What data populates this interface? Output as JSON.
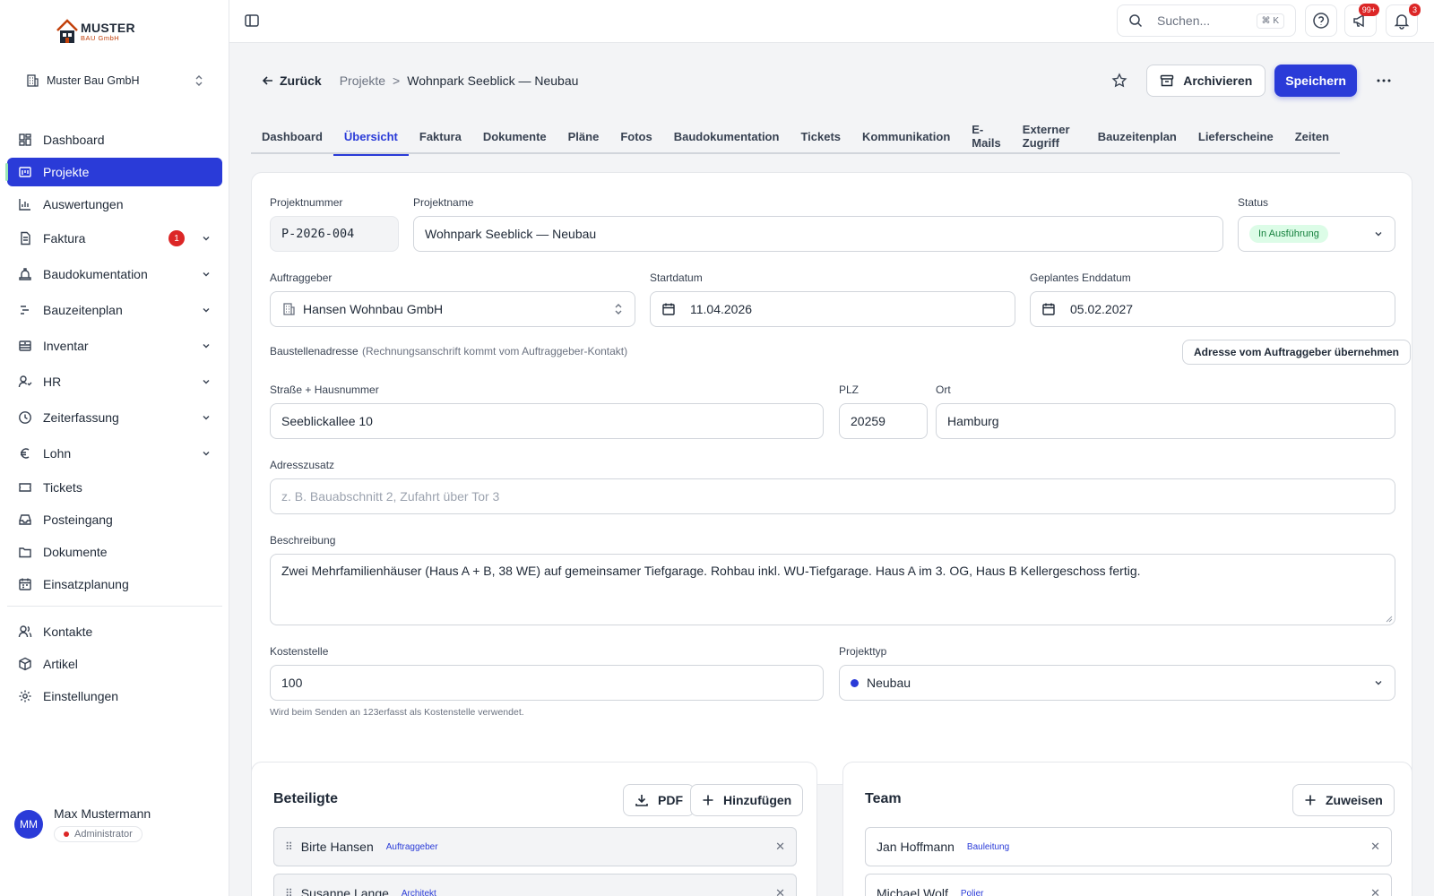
{
  "brand": {
    "name": "MUSTER",
    "sub": "BAU GmbH"
  },
  "company": {
    "name": "Muster Bau GmbH"
  },
  "nav": {
    "items": [
      {
        "label": "Dashboard",
        "icon": "dashboard-icon"
      },
      {
        "label": "Projekte",
        "icon": "projects-icon",
        "active": true
      },
      {
        "label": "Auswertungen",
        "icon": "chart-icon"
      },
      {
        "label": "Faktura",
        "icon": "invoice-icon",
        "badge": "1"
      },
      {
        "label": "Baudokumentation",
        "icon": "construction-icon"
      },
      {
        "label": "Bauzeitenplan",
        "icon": "gantt-icon"
      },
      {
        "label": "Inventar",
        "icon": "inventory-icon"
      },
      {
        "label": "HR",
        "icon": "hr-icon"
      },
      {
        "label": "Zeiterfassung",
        "icon": "clock-icon"
      },
      {
        "label": "Lohn",
        "icon": "euro-icon"
      },
      {
        "label": "Tickets",
        "icon": "ticket-icon"
      },
      {
        "label": "Posteingang",
        "icon": "inbox-icon"
      },
      {
        "label": "Dokumente",
        "icon": "folder-icon"
      },
      {
        "label": "Einsatzplanung",
        "icon": "calendar-icon"
      },
      {
        "label": "Kontakte",
        "icon": "contacts-icon"
      },
      {
        "label": "Artikel",
        "icon": "package-icon"
      },
      {
        "label": "Einstellungen",
        "icon": "gear-icon"
      }
    ]
  },
  "user": {
    "initials": "MM",
    "name": "Max Mustermann",
    "role": "Administrator"
  },
  "topbar": {
    "search_placeholder": "Suchen...",
    "shortcut": "⌘ K",
    "notifications_badge": "99+",
    "bell_badge": "3"
  },
  "header": {
    "back_label": "Zurück",
    "breadcrumb_parent": "Projekte",
    "breadcrumb_sep": ">",
    "breadcrumb_current": "Wohnpark Seeblick — Neubau",
    "archive_label": "Archivieren",
    "save_label": "Speichern"
  },
  "tabs": [
    "Dashboard",
    "Übersicht",
    "Faktura",
    "Dokumente",
    "Pläne",
    "Fotos",
    "Baudokumentation",
    "Tickets",
    "Kommunikation",
    "E-Mails",
    "Externer Zugriff",
    "Bauzeitenplan",
    "Lieferscheine",
    "Zeiten"
  ],
  "form": {
    "projektnummer_label": "Projektnummer",
    "projektnummer": "P-2026-004",
    "projektname_label": "Projektname",
    "projektname": "Wohnpark Seeblick — Neubau",
    "status_label": "Status",
    "status": "In Ausführung",
    "auftraggeber_label": "Auftraggeber",
    "auftraggeber": "Hansen Wohnbau GmbH",
    "startdatum_label": "Startdatum",
    "startdatum": "11.04.2026",
    "enddatum_label": "Geplantes Enddatum",
    "enddatum": "05.02.2027",
    "adresse_label": "Baustellenadresse",
    "adresse_hint": "(Rechnungsanschrift kommt vom Auftraggeber-Kontakt)",
    "adresse_button": "Adresse vom Auftraggeber übernehmen",
    "strasse_label": "Straße + Hausnummer",
    "strasse": "Seeblickallee 10",
    "plz_label": "PLZ",
    "plz": "20259",
    "ort_label": "Ort",
    "ort": "Hamburg",
    "zusatz_label": "Adresszusatz",
    "zusatz_placeholder": "z. B. Bauabschnitt 2, Zufahrt über Tor 3",
    "beschreibung_label": "Beschreibung",
    "beschreibung": "Zwei Mehrfamilienhäuser (Haus A + B, 38 WE) auf gemeinsamer Tiefgarage. Rohbau inkl. WU-Tiefgarage. Haus A im 3. OG, Haus B Kellergeschoss fertig.",
    "kostenstelle_label": "Kostenstelle",
    "kostenstelle": "100",
    "kostenstelle_help": "Wird beim Senden an 123erfasst als Kostenstelle verwendet.",
    "projekttyp_label": "Projekttyp",
    "projekttyp": "Neubau"
  },
  "beteiligte": {
    "title": "Beteiligte",
    "pdf_label": "PDF",
    "add_label": "Hinzufügen",
    "rows": [
      {
        "name": "Birte Hansen",
        "role": "Auftraggeber"
      },
      {
        "name": "Susanne Lange",
        "role": "Architekt"
      }
    ]
  },
  "team": {
    "title": "Team",
    "assign_label": "Zuweisen",
    "rows": [
      {
        "name": "Jan Hoffmann",
        "role": "Bauleitung"
      },
      {
        "name": "Michael Wolf",
        "role": "Polier"
      }
    ]
  },
  "colors": {
    "primary": "#2a3bd8",
    "danger": "#dc2626",
    "success_bg": "#dcfce7",
    "success_text": "#15803d",
    "projekttyp_dot": "#2a3bd8"
  }
}
